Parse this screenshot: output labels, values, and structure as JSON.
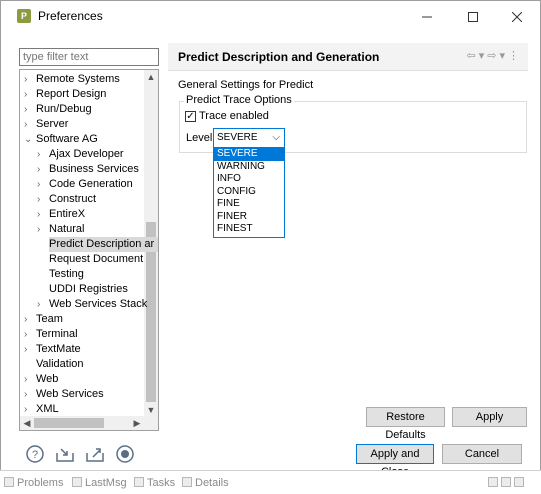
{
  "window": {
    "title": "Preferences",
    "icon_letter": "P"
  },
  "filter": {
    "placeholder": "type filter text"
  },
  "tree": {
    "items": [
      {
        "label": "Remote Systems",
        "level": 0,
        "chevron": ">"
      },
      {
        "label": "Report Design",
        "level": 0,
        "chevron": ">"
      },
      {
        "label": "Run/Debug",
        "level": 0,
        "chevron": ">"
      },
      {
        "label": "Server",
        "level": 0,
        "chevron": ">"
      },
      {
        "label": "Software AG",
        "level": 0,
        "chevron": "v"
      },
      {
        "label": "Ajax Developer",
        "level": 1,
        "chevron": ">"
      },
      {
        "label": "Business Services",
        "level": 1,
        "chevron": ">"
      },
      {
        "label": "Code Generation",
        "level": 1,
        "chevron": ">"
      },
      {
        "label": "Construct",
        "level": 1,
        "chevron": ">"
      },
      {
        "label": "EntireX",
        "level": 1,
        "chevron": ">"
      },
      {
        "label": "Natural",
        "level": 1,
        "chevron": ">"
      },
      {
        "label": "Predict Description ar",
        "level": 1,
        "chevron": "",
        "selected": true
      },
      {
        "label": "Request Document",
        "level": 1,
        "chevron": ""
      },
      {
        "label": "Testing",
        "level": 1,
        "chevron": ""
      },
      {
        "label": "UDDI Registries",
        "level": 1,
        "chevron": ""
      },
      {
        "label": "Web Services Stack",
        "level": 1,
        "chevron": ">"
      },
      {
        "label": "Team",
        "level": 0,
        "chevron": ">"
      },
      {
        "label": "Terminal",
        "level": 0,
        "chevron": ">"
      },
      {
        "label": "TextMate",
        "level": 0,
        "chevron": ">"
      },
      {
        "label": "Validation",
        "level": 0,
        "chevron": ""
      },
      {
        "label": "Web",
        "level": 0,
        "chevron": ">"
      },
      {
        "label": "Web Services",
        "level": 0,
        "chevron": ">"
      },
      {
        "label": "XML",
        "level": 0,
        "chevron": ">"
      }
    ]
  },
  "page": {
    "title": "Predict Description and Generation",
    "general_label": "General Settings for Predict",
    "group_label": "Predict Trace Options",
    "trace_enabled_label": "Trace enabled",
    "trace_enabled": true,
    "level_label": "Level",
    "level_value": "SEVERE",
    "level_options": [
      "SEVERE",
      "WARNING",
      "INFO",
      "CONFIG",
      "FINE",
      "FINER",
      "FINEST"
    ],
    "restore_defaults": "Restore Defaults",
    "apply": "Apply"
  },
  "footer": {
    "apply_and_close": "Apply and Close",
    "cancel": "Cancel"
  },
  "statusbar": {
    "items": [
      "Problems",
      "LastMsg",
      "Tasks",
      "Details"
    ]
  }
}
